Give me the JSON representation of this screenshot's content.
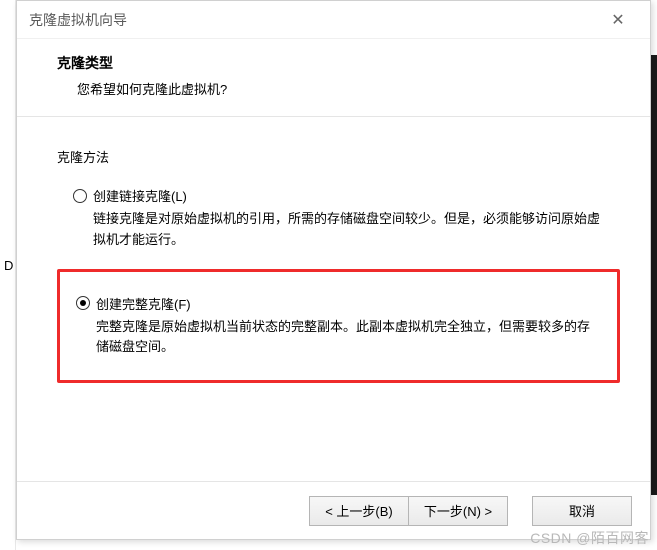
{
  "left_char": "D",
  "dialog": {
    "title": "克隆虚拟机向导",
    "header": {
      "title": "克隆类型",
      "subtitle": "您希望如何克隆此虚拟机?"
    },
    "group_title": "克隆方法",
    "options": {
      "linked": {
        "label": "创建链接克隆(L)",
        "desc": "链接克隆是对原始虚拟机的引用，所需的存储磁盘空间较少。但是，必须能够访问原始虚拟机才能运行。",
        "selected": false
      },
      "full": {
        "label": "创建完整克隆(F)",
        "desc": "完整克隆是原始虚拟机当前状态的完整副本。此副本虚拟机完全独立，但需要较多的存储磁盘空间。",
        "selected": true
      }
    },
    "buttons": {
      "back": "< 上一步(B)",
      "next": "下一步(N) >",
      "cancel": "取消"
    }
  },
  "watermark": "CSDN @陌百网客"
}
